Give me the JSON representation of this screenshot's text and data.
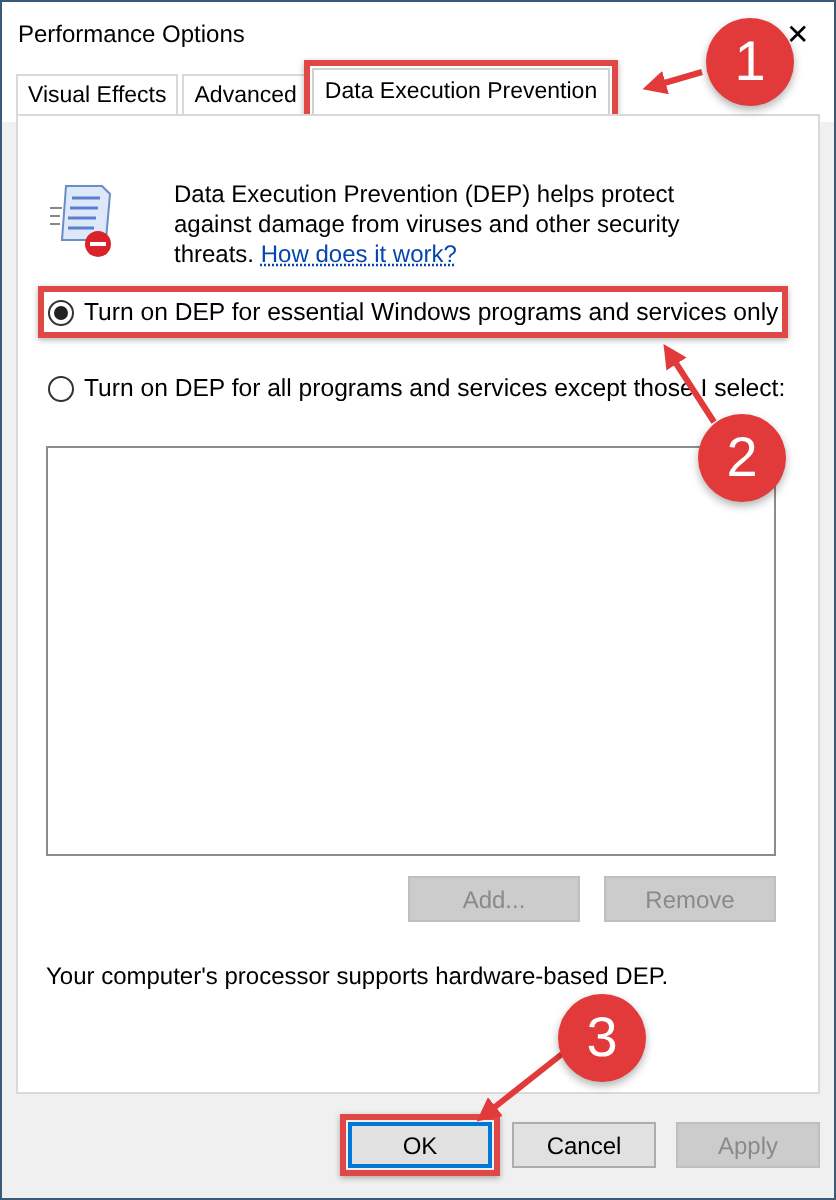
{
  "window": {
    "title": "Performance Options",
    "close": "✕"
  },
  "tabs": [
    {
      "label": "Visual Effects",
      "selected": false,
      "highlighted": false
    },
    {
      "label": "Advanced",
      "selected": false,
      "highlighted": false
    },
    {
      "label": "Data Execution Prevention",
      "selected": true,
      "highlighted": true
    }
  ],
  "description": {
    "text": "Data Execution Prevention (DEP) helps protect against damage from viruses and other security threats.",
    "link": "How does it work?"
  },
  "options": [
    {
      "label": "Turn on DEP for essential Windows programs and services only",
      "selected": true,
      "highlighted": true
    },
    {
      "label": "Turn on DEP for all programs and services except those I select:",
      "selected": false,
      "highlighted": false
    }
  ],
  "list_buttons": [
    {
      "label": "Add...",
      "disabled": true
    },
    {
      "label": "Remove",
      "disabled": true
    }
  ],
  "status": "Your computer's processor supports hardware-based DEP.",
  "buttons": [
    {
      "label": "OK",
      "disabled": false,
      "highlighted": true
    },
    {
      "label": "Cancel",
      "disabled": false,
      "highlighted": false
    },
    {
      "label": "Apply",
      "disabled": true,
      "highlighted": false
    }
  ],
  "annotations": [
    {
      "label": "1"
    },
    {
      "label": "2"
    },
    {
      "label": "3"
    }
  ]
}
